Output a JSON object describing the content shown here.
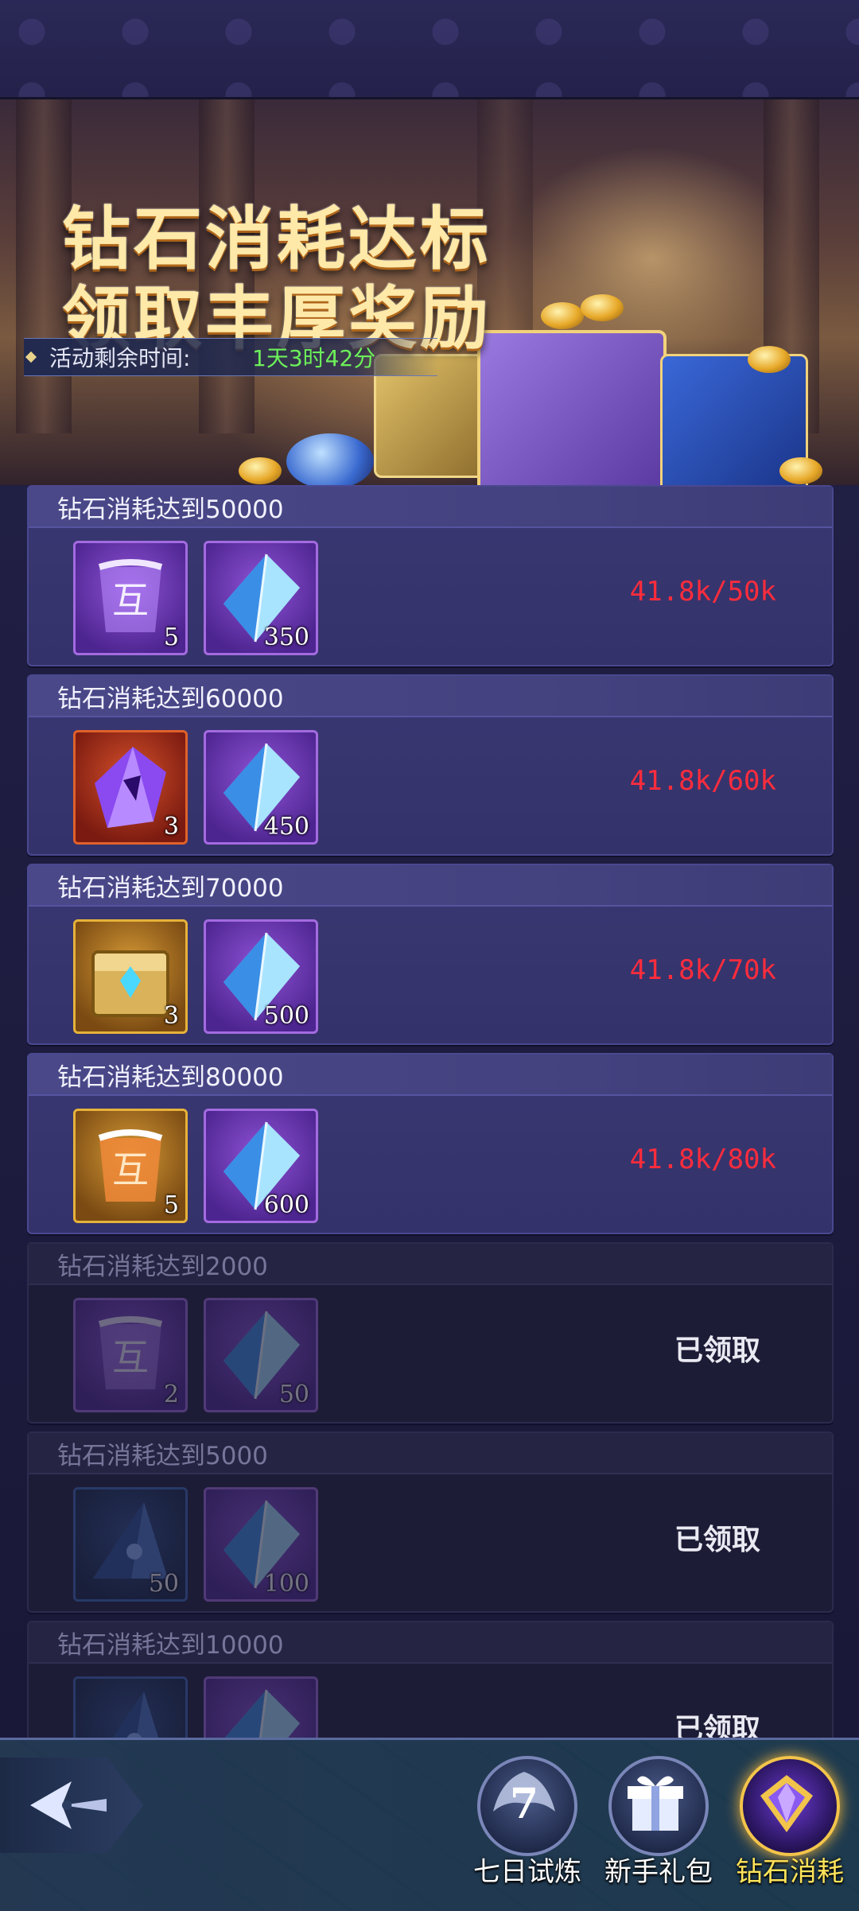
{
  "banner": {
    "title_line1": "钻石消耗达标",
    "title_line2": "领取丰厚奖励",
    "timer_label": "活动剩余时间:",
    "timer_value": "1天3时42分"
  },
  "colors": {
    "progress_text": "#ff2c3c",
    "timer_value": "#6cf05a",
    "active_tab_label": "#ffe45a"
  },
  "tasks": [
    {
      "title": "钻石消耗达到50000",
      "status": "in_progress",
      "progress": "41.8k/50k",
      "rewards": [
        {
          "icon": "purple-scroll-icon",
          "qty": "5"
        },
        {
          "icon": "blue-diamond-icon",
          "qty": "350"
        }
      ]
    },
    {
      "title": "钻石消耗达到60000",
      "status": "in_progress",
      "progress": "41.8k/60k",
      "rewards": [
        {
          "icon": "purple-crystal-icon",
          "qty": "3"
        },
        {
          "icon": "blue-diamond-icon",
          "qty": "450"
        }
      ]
    },
    {
      "title": "钻石消耗达到70000",
      "status": "in_progress",
      "progress": "41.8k/70k",
      "rewards": [
        {
          "icon": "golden-chest-icon",
          "qty": "3"
        },
        {
          "icon": "blue-diamond-icon",
          "qty": "500"
        }
      ]
    },
    {
      "title": "钻石消耗达到80000",
      "status": "in_progress",
      "progress": "41.8k/80k",
      "rewards": [
        {
          "icon": "gold-scroll-icon",
          "qty": "5"
        },
        {
          "icon": "blue-diamond-icon",
          "qty": "600"
        }
      ]
    },
    {
      "title": "钻石消耗达到2000",
      "status": "claimed",
      "claimed_label": "已领取",
      "rewards": [
        {
          "icon": "purple-scroll-icon",
          "qty": "2"
        },
        {
          "icon": "blue-diamond-icon",
          "qty": "50"
        }
      ]
    },
    {
      "title": "钻石消耗达到5000",
      "status": "claimed",
      "claimed_label": "已领取",
      "rewards": [
        {
          "icon": "blue-shard-icon",
          "qty": "50"
        },
        {
          "icon": "blue-diamond-icon",
          "qty": "100"
        }
      ]
    },
    {
      "title": "钻石消耗达到10000",
      "status": "claimed",
      "claimed_label": "已领取",
      "rewards": [
        {
          "icon": "blue-shard-icon",
          "qty": ""
        },
        {
          "icon": "blue-diamond-icon",
          "qty": ""
        }
      ]
    }
  ],
  "bottom_nav": {
    "back_icon": "back-arrow-icon",
    "tabs": [
      {
        "label": "七日试炼",
        "icon": "seven-day-trial-icon",
        "badge_text": "7"
      },
      {
        "label": "新手礼包",
        "icon": "gift-box-icon"
      },
      {
        "label": "钻石消耗",
        "icon": "diamond-consume-icon",
        "active": true
      }
    ]
  }
}
